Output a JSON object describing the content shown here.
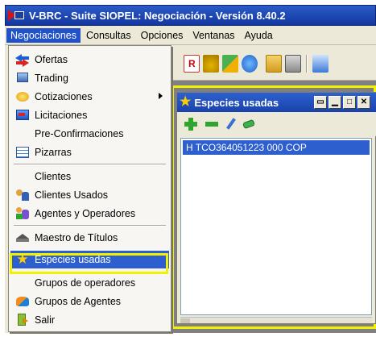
{
  "window": {
    "title": "V-BRC - Suite SIOPEL: Negociación - Versión 8.40.2"
  },
  "menubar": [
    {
      "label": "Negociaciones",
      "active": true
    },
    {
      "label": "Consultas",
      "active": false
    },
    {
      "label": "Opciones",
      "active": false
    },
    {
      "label": "Ventanas",
      "active": false
    },
    {
      "label": "Ayuda",
      "active": false
    }
  ],
  "menu": {
    "items": [
      {
        "label": "Ofertas",
        "icon": "arrows-swap-icon"
      },
      {
        "label": "Trading",
        "icon": "trading-icon"
      },
      {
        "label": "Cotizaciones",
        "icon": "quotes-icon",
        "submenu": true
      },
      {
        "label": "Licitaciones",
        "icon": "auction-icon"
      },
      {
        "label": "Pre-Confirmaciones",
        "icon": ""
      },
      {
        "label": "Pizarras",
        "icon": "board-icon"
      },
      {
        "label": "Clientes",
        "icon": ""
      },
      {
        "label": "Clientes Usados",
        "icon": "clients-icon"
      },
      {
        "label": "Agentes y Operadores",
        "icon": "agents-icon"
      },
      {
        "label": "Maestro de Títulos",
        "icon": "graduation-cap-icon"
      },
      {
        "label": "Especies usadas",
        "icon": "star-icon",
        "selected": true
      },
      {
        "label": "Grupos de operadores",
        "icon": ""
      },
      {
        "label": "Grupos de Agentes",
        "icon": "groups-icon"
      },
      {
        "label": "Salir",
        "icon": "exit-icon"
      }
    ]
  },
  "panel": {
    "title": "Especies usadas",
    "list": [
      "H TCO364051223 000 COP"
    ]
  },
  "colors": {
    "titlebar": "#1a42ab",
    "selection": "#2e5fcf",
    "highlight": "#f2f200"
  }
}
